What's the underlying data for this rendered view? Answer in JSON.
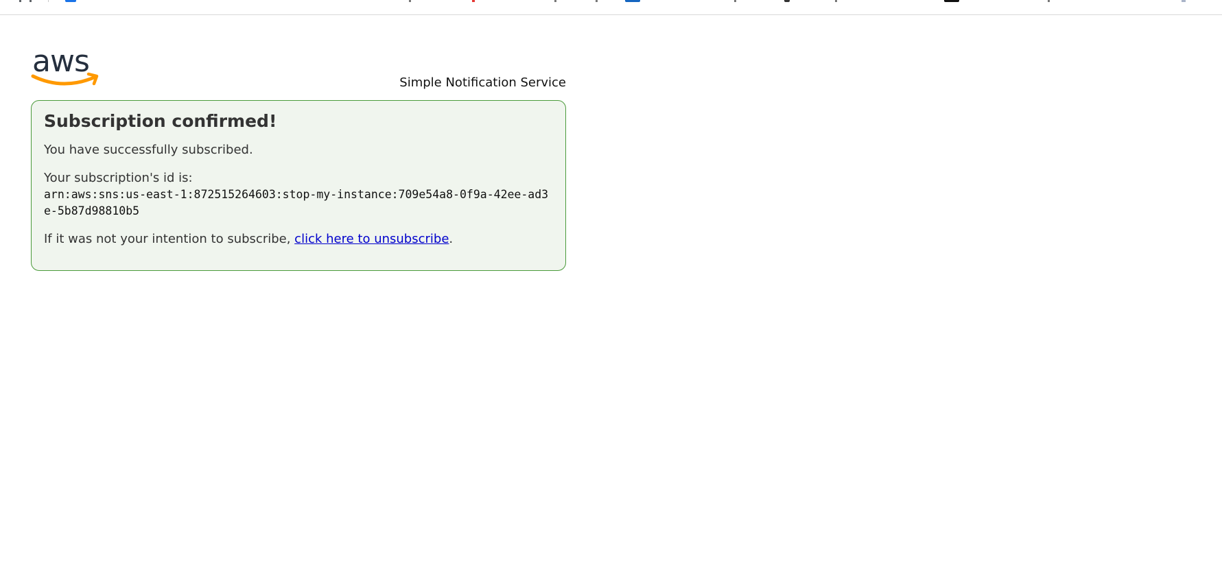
{
  "header": {
    "service_name": "Simple Notification Service",
    "logo_text": "aws"
  },
  "confirmation": {
    "title": "Subscription confirmed!",
    "success_text": "You have successfully subscribed.",
    "id_label": "Your subscription's id is:",
    "subscription_arn": "arn:aws:sns:us-east-1:872515264603:stop-my-instance:709e54a8-0f9a-42ee-ad3e-5b87d98810b5",
    "unsubscribe_prefix": "If it was not your intention to subscribe, ",
    "unsubscribe_link": "click here to unsubscribe",
    "unsubscribe_suffix": "."
  },
  "colors": {
    "box_border": "#4a9a3a",
    "box_background": "#f0f5ee",
    "link": "#0000cc",
    "aws_orange": "#ff9900",
    "aws_navy": "#252f3e"
  }
}
